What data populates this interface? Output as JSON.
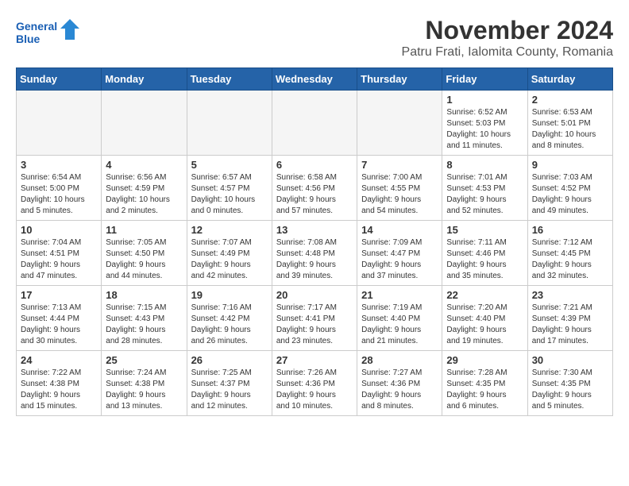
{
  "header": {
    "logo_line1": "General",
    "logo_line2": "Blue",
    "title": "November 2024",
    "location": "Patru Frati, Ialomita County, Romania"
  },
  "weekdays": [
    "Sunday",
    "Monday",
    "Tuesday",
    "Wednesday",
    "Thursday",
    "Friday",
    "Saturday"
  ],
  "weeks": [
    [
      {
        "day": "",
        "info": "",
        "empty": true
      },
      {
        "day": "",
        "info": "",
        "empty": true
      },
      {
        "day": "",
        "info": "",
        "empty": true
      },
      {
        "day": "",
        "info": "",
        "empty": true
      },
      {
        "day": "",
        "info": "",
        "empty": true
      },
      {
        "day": "1",
        "info": "Sunrise: 6:52 AM\nSunset: 5:03 PM\nDaylight: 10 hours\nand 11 minutes."
      },
      {
        "day": "2",
        "info": "Sunrise: 6:53 AM\nSunset: 5:01 PM\nDaylight: 10 hours\nand 8 minutes."
      }
    ],
    [
      {
        "day": "3",
        "info": "Sunrise: 6:54 AM\nSunset: 5:00 PM\nDaylight: 10 hours\nand 5 minutes."
      },
      {
        "day": "4",
        "info": "Sunrise: 6:56 AM\nSunset: 4:59 PM\nDaylight: 10 hours\nand 2 minutes."
      },
      {
        "day": "5",
        "info": "Sunrise: 6:57 AM\nSunset: 4:57 PM\nDaylight: 10 hours\nand 0 minutes."
      },
      {
        "day": "6",
        "info": "Sunrise: 6:58 AM\nSunset: 4:56 PM\nDaylight: 9 hours\nand 57 minutes."
      },
      {
        "day": "7",
        "info": "Sunrise: 7:00 AM\nSunset: 4:55 PM\nDaylight: 9 hours\nand 54 minutes."
      },
      {
        "day": "8",
        "info": "Sunrise: 7:01 AM\nSunset: 4:53 PM\nDaylight: 9 hours\nand 52 minutes."
      },
      {
        "day": "9",
        "info": "Sunrise: 7:03 AM\nSunset: 4:52 PM\nDaylight: 9 hours\nand 49 minutes."
      }
    ],
    [
      {
        "day": "10",
        "info": "Sunrise: 7:04 AM\nSunset: 4:51 PM\nDaylight: 9 hours\nand 47 minutes."
      },
      {
        "day": "11",
        "info": "Sunrise: 7:05 AM\nSunset: 4:50 PM\nDaylight: 9 hours\nand 44 minutes."
      },
      {
        "day": "12",
        "info": "Sunrise: 7:07 AM\nSunset: 4:49 PM\nDaylight: 9 hours\nand 42 minutes."
      },
      {
        "day": "13",
        "info": "Sunrise: 7:08 AM\nSunset: 4:48 PM\nDaylight: 9 hours\nand 39 minutes."
      },
      {
        "day": "14",
        "info": "Sunrise: 7:09 AM\nSunset: 4:47 PM\nDaylight: 9 hours\nand 37 minutes."
      },
      {
        "day": "15",
        "info": "Sunrise: 7:11 AM\nSunset: 4:46 PM\nDaylight: 9 hours\nand 35 minutes."
      },
      {
        "day": "16",
        "info": "Sunrise: 7:12 AM\nSunset: 4:45 PM\nDaylight: 9 hours\nand 32 minutes."
      }
    ],
    [
      {
        "day": "17",
        "info": "Sunrise: 7:13 AM\nSunset: 4:44 PM\nDaylight: 9 hours\nand 30 minutes."
      },
      {
        "day": "18",
        "info": "Sunrise: 7:15 AM\nSunset: 4:43 PM\nDaylight: 9 hours\nand 28 minutes."
      },
      {
        "day": "19",
        "info": "Sunrise: 7:16 AM\nSunset: 4:42 PM\nDaylight: 9 hours\nand 26 minutes."
      },
      {
        "day": "20",
        "info": "Sunrise: 7:17 AM\nSunset: 4:41 PM\nDaylight: 9 hours\nand 23 minutes."
      },
      {
        "day": "21",
        "info": "Sunrise: 7:19 AM\nSunset: 4:40 PM\nDaylight: 9 hours\nand 21 minutes."
      },
      {
        "day": "22",
        "info": "Sunrise: 7:20 AM\nSunset: 4:40 PM\nDaylight: 9 hours\nand 19 minutes."
      },
      {
        "day": "23",
        "info": "Sunrise: 7:21 AM\nSunset: 4:39 PM\nDaylight: 9 hours\nand 17 minutes."
      }
    ],
    [
      {
        "day": "24",
        "info": "Sunrise: 7:22 AM\nSunset: 4:38 PM\nDaylight: 9 hours\nand 15 minutes."
      },
      {
        "day": "25",
        "info": "Sunrise: 7:24 AM\nSunset: 4:38 PM\nDaylight: 9 hours\nand 13 minutes."
      },
      {
        "day": "26",
        "info": "Sunrise: 7:25 AM\nSunset: 4:37 PM\nDaylight: 9 hours\nand 12 minutes."
      },
      {
        "day": "27",
        "info": "Sunrise: 7:26 AM\nSunset: 4:36 PM\nDaylight: 9 hours\nand 10 minutes."
      },
      {
        "day": "28",
        "info": "Sunrise: 7:27 AM\nSunset: 4:36 PM\nDaylight: 9 hours\nand 8 minutes."
      },
      {
        "day": "29",
        "info": "Sunrise: 7:28 AM\nSunset: 4:35 PM\nDaylight: 9 hours\nand 6 minutes."
      },
      {
        "day": "30",
        "info": "Sunrise: 7:30 AM\nSunset: 4:35 PM\nDaylight: 9 hours\nand 5 minutes."
      }
    ]
  ]
}
